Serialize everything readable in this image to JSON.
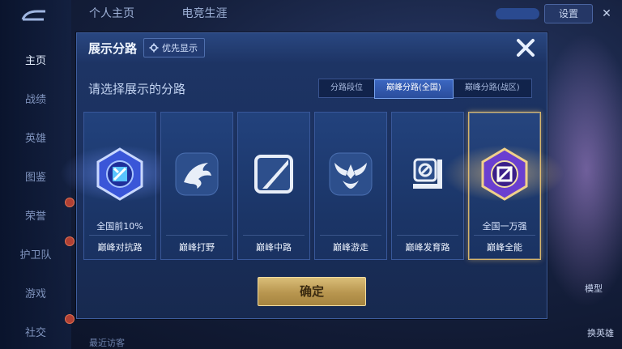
{
  "background": {
    "top_tabs": [
      "个人主页",
      "电竞生涯"
    ],
    "settings_label": "设置",
    "left_nav": [
      "主页",
      "战绩",
      "英雄",
      "图鉴",
      "荣誉",
      "护卫队",
      "游戏",
      "社交"
    ],
    "right_labels": [
      "模型",
      "换英雄"
    ],
    "bottom_text": "最近访客"
  },
  "modal": {
    "title": "展示分路",
    "pref_label": "优先显示",
    "subtitle": "请选择展示的分路",
    "tabs": [
      "分路段位",
      "巅峰分路(全国)",
      "巅峰分路(战区)"
    ],
    "selected_tab_index": 1,
    "cards": [
      {
        "lane": "巅峰对抗路",
        "rank": "全国前10%",
        "icon": "duel-lane-blue-emblem-icon",
        "highlight": "blue"
      },
      {
        "lane": "巅峰打野",
        "rank": "",
        "icon": "jungle-dragon-icon",
        "highlight": "none"
      },
      {
        "lane": "巅峰中路",
        "rank": "",
        "icon": "mid-lane-slash-icon",
        "highlight": "none"
      },
      {
        "lane": "巅峰游走",
        "rank": "",
        "icon": "roam-wings-icon",
        "highlight": "none"
      },
      {
        "lane": "巅峰发育路",
        "rank": "",
        "icon": "farm-lane-icon",
        "highlight": "none"
      },
      {
        "lane": "巅峰全能",
        "rank": "全国一万强",
        "icon": "all-round-purple-emblem-icon",
        "highlight": "gold"
      }
    ],
    "selected_card_index": 5,
    "confirm_label": "确定"
  },
  "colors": {
    "accent_blue": "#2a4d9c",
    "gold": "#d7b56a",
    "panel": "#1e3566"
  }
}
